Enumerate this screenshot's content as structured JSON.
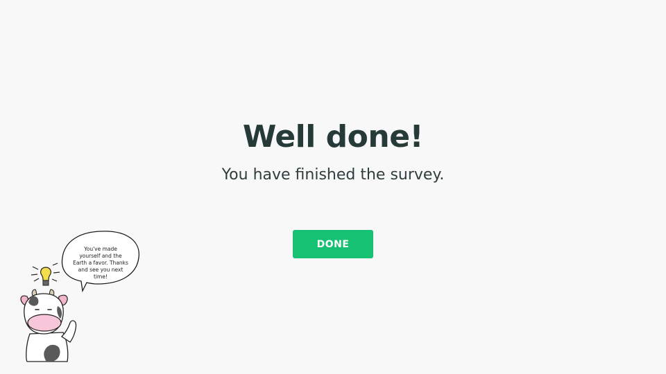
{
  "headline": "Well done!",
  "subline": "You have finished the survey.",
  "done_button": {
    "label": "DONE",
    "color": "#17c174"
  },
  "mascot": {
    "speech": "You've made yourself and the Earth a favor. Thanks and see you next time!"
  },
  "colors": {
    "background": "#f8f8f8",
    "text": "#263a38"
  }
}
